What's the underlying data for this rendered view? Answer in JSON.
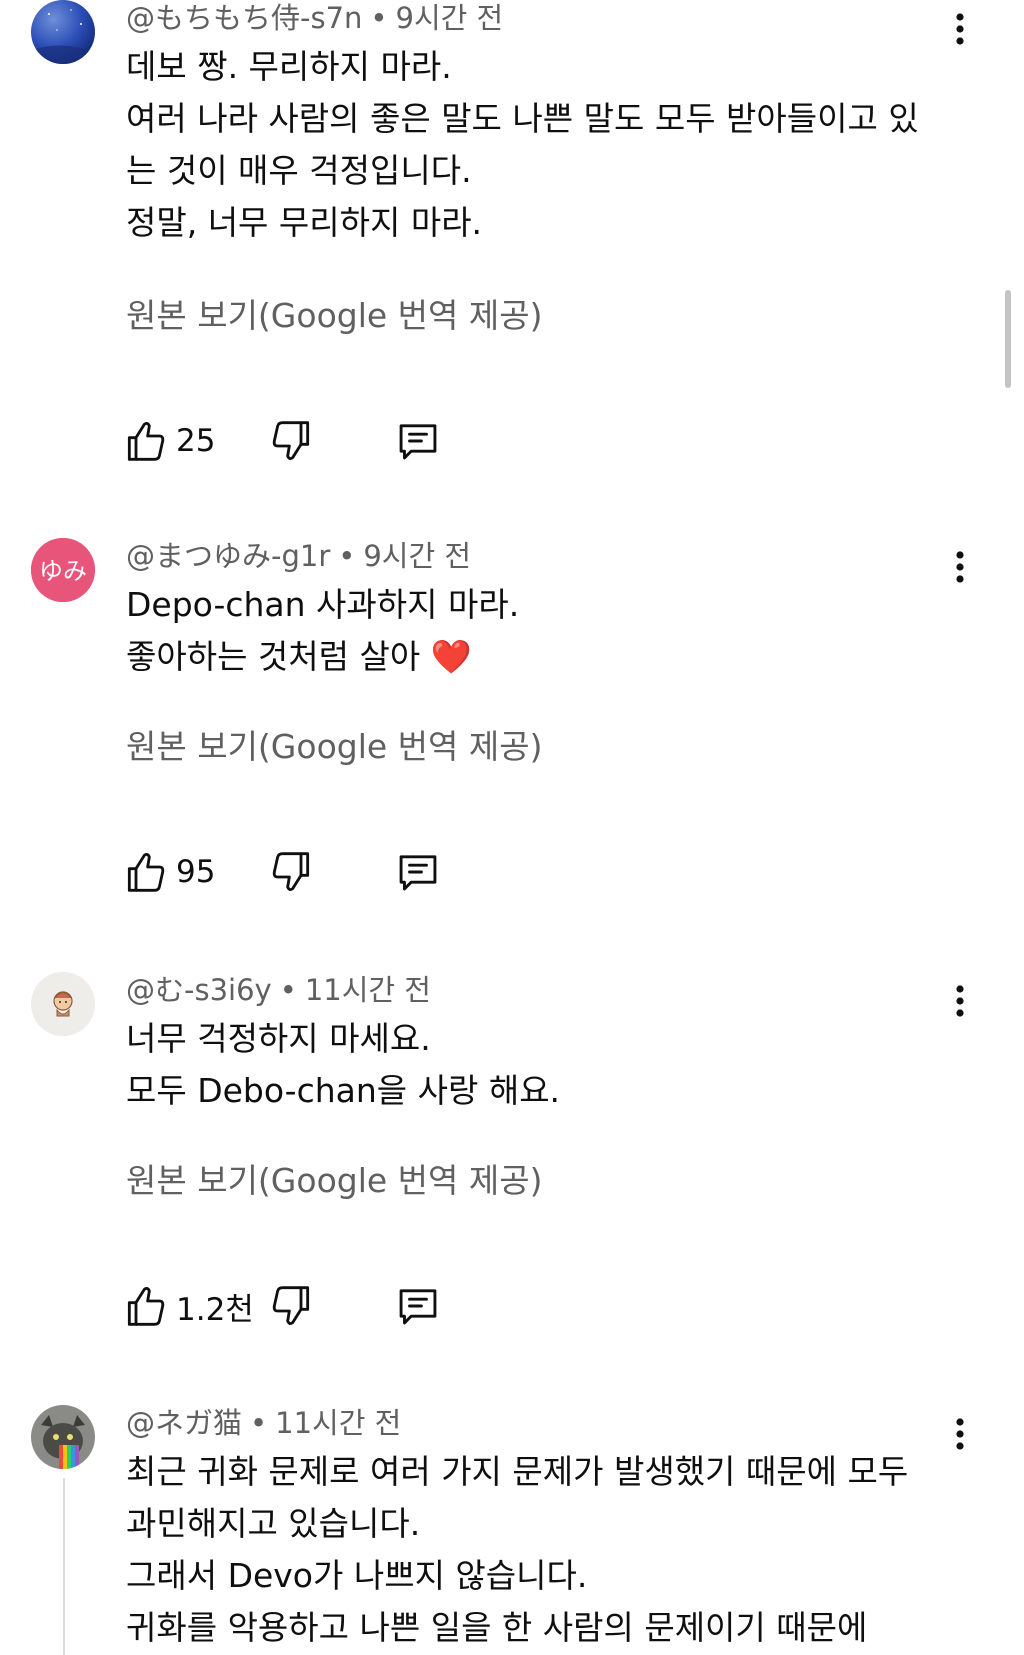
{
  "comments": [
    {
      "author": "@もちもち侍-s7n",
      "time": "9시간 전",
      "lines": [
        "데보 짱. 무리하지 마라.",
        "여러 나라 사람의 좋은 말도 나쁜 말도 모두 받아들이고 있",
        "는 것이 매우 걱정입니다.",
        "정말, 너무 무리하지 마라."
      ],
      "translate_label": "원본 보기(Google 번역 제공)",
      "like_count": "25",
      "avatar_icon": "night-sky-avatar"
    },
    {
      "author": "@まつゆみ-g1r",
      "time": "9시간 전",
      "lines": [
        "Depo-chan 사과하지 마라.",
        "좋아하는 것처럼 살아 ❤️"
      ],
      "translate_label": "원본 보기(Google 번역 제공)",
      "like_count": "95",
      "avatar_icon": "text-avatar",
      "avatar_text": "ゆみ",
      "avatar_color": "#e8557a"
    },
    {
      "author": "@む-s3i6y",
      "time": "11시간 전",
      "lines": [
        "너무 걱정하지 마세요.",
        "모두 Debo-chan을 사랑 해요."
      ],
      "translate_label": "원본 보기(Google 번역 제공)",
      "like_count": "1.2천",
      "avatar_icon": "character-avatar"
    },
    {
      "author": "@ネガ猫",
      "time": "11시간 전",
      "lines": [
        "최근 귀화 문제로 여러 가지 문제가 발생했기 때문에 모두",
        "과민해지고 있습니다.",
        "그래서 Devo가 나쁘지 않습니다.",
        "귀화를 악용하고 나쁜 일을 한 사람의 문제이기 때문에"
      ],
      "avatar_icon": "rainbow-cat-avatar"
    }
  ],
  "icons": {
    "like": "thumbs-up-icon",
    "dislike": "thumbs-down-icon",
    "reply": "reply-comment-icon",
    "more": "more-vertical-icon"
  },
  "colors": {
    "text_primary": "#0f0f0f",
    "text_secondary": "#606060"
  }
}
